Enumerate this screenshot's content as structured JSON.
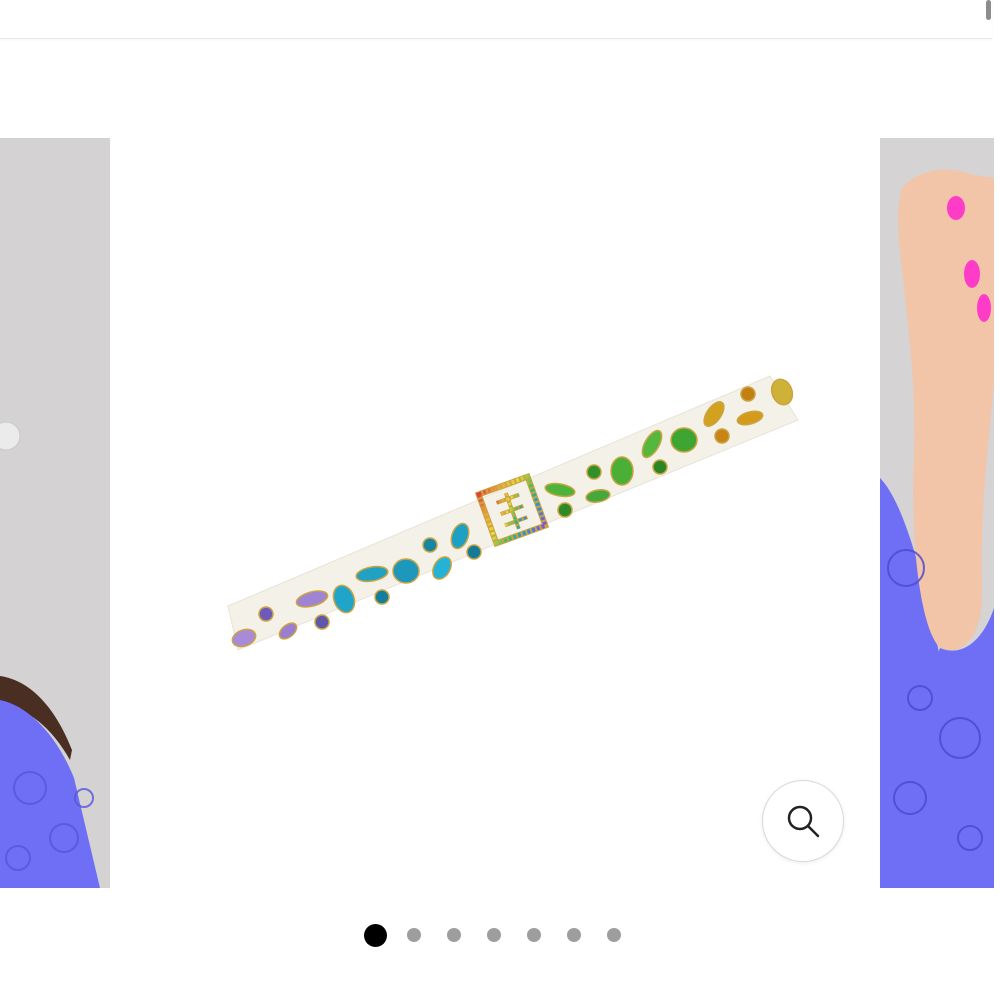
{
  "gallery": {
    "slide_count": 7,
    "active_index": 0,
    "slides": [
      {
        "name": "model-wearing-dress-left"
      },
      {
        "name": "rainbow-crystal-choker"
      },
      {
        "name": "model-raised-hand-right"
      }
    ]
  },
  "zoom": {
    "icon": "magnifier-icon"
  },
  "colors": {
    "dot_active": "#000000",
    "dot_inactive": "#9e9e9e",
    "dress_purple": "#6f6ff5",
    "nail_pink": "#ff3cc8",
    "wall_gray": "#d4d2d3"
  }
}
